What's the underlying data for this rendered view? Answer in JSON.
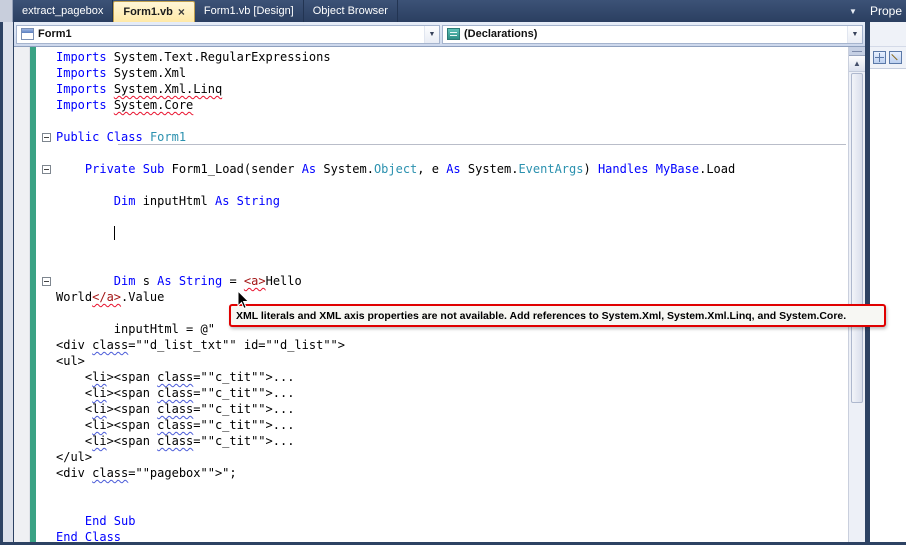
{
  "colors": {
    "keyword": "#0000FF",
    "type": "#2B91AF",
    "xml_literal": "#A31515",
    "squiggle_error": "#E8112D",
    "squiggle_warning": "#4A5BD8",
    "change_bar": "#3AA284",
    "active_tab": "#FFE9A7",
    "title_bar": "#2D4263",
    "error_border": "#E00000"
  },
  "icons": {
    "close": "×",
    "tab_overflow": "▼",
    "combo_dropdown": "▼",
    "scroll_up": "▲"
  },
  "tabbar": {
    "tabs": [
      {
        "label": "extract_pagebox",
        "active": false,
        "close": false
      },
      {
        "label": "Form1.vb",
        "active": true,
        "close": true
      },
      {
        "label": "Form1.vb [Design]",
        "active": false,
        "close": false
      },
      {
        "label": "Object Browser",
        "active": false,
        "close": false
      }
    ],
    "right_panel_title": "Prope"
  },
  "navbar": {
    "object_combo": "Form1",
    "member_combo": "(Declarations)"
  },
  "tooltip": {
    "text": "XML literals and XML axis properties are not available. Add references to System.Xml, System.Xml.Linq, and System.Core."
  },
  "code": {
    "lines": [
      {
        "s": [
          {
            "t": "Imports",
            "c": "kw"
          },
          {
            "t": " System.Text.RegularExpressions",
            "c": "pl"
          }
        ]
      },
      {
        "s": [
          {
            "t": "Imports",
            "c": "kw"
          },
          {
            "t": " System.Xml",
            "c": "pl"
          }
        ]
      },
      {
        "s": [
          {
            "t": "Imports",
            "c": "kw"
          },
          {
            "t": " ",
            "c": "pl"
          },
          {
            "t": "System.Xml.Linq",
            "c": "pl",
            "sq": "red"
          }
        ]
      },
      {
        "s": [
          {
            "t": "Imports",
            "c": "kw"
          },
          {
            "t": " ",
            "c": "pl"
          },
          {
            "t": "System.Core",
            "c": "pl",
            "sq": "red"
          }
        ]
      },
      {
        "s": []
      },
      {
        "fold": true,
        "sep": true,
        "s": [
          {
            "t": "Public",
            "c": "kw"
          },
          {
            "t": " ",
            "c": "pl"
          },
          {
            "t": "Class",
            "c": "kw"
          },
          {
            "t": " ",
            "c": "pl"
          },
          {
            "t": "Form1",
            "c": "ty"
          }
        ]
      },
      {
        "s": []
      },
      {
        "fold": true,
        "s": [
          {
            "t": "    ",
            "c": "pl"
          },
          {
            "t": "Private",
            "c": "kw"
          },
          {
            "t": " ",
            "c": "pl"
          },
          {
            "t": "Sub",
            "c": "kw"
          },
          {
            "t": " Form1_Load(sender ",
            "c": "pl"
          },
          {
            "t": "As",
            "c": "kw"
          },
          {
            "t": " System.",
            "c": "pl"
          },
          {
            "t": "Object",
            "c": "ty"
          },
          {
            "t": ", e ",
            "c": "pl"
          },
          {
            "t": "As",
            "c": "kw"
          },
          {
            "t": " System.",
            "c": "pl"
          },
          {
            "t": "EventArgs",
            "c": "ty"
          },
          {
            "t": ") ",
            "c": "pl"
          },
          {
            "t": "Handles",
            "c": "kw"
          },
          {
            "t": " ",
            "c": "pl"
          },
          {
            "t": "MyBase",
            "c": "kw"
          },
          {
            "t": ".Load",
            "c": "pl"
          }
        ]
      },
      {
        "s": []
      },
      {
        "s": [
          {
            "t": "        ",
            "c": "pl"
          },
          {
            "t": "Dim",
            "c": "kw"
          },
          {
            "t": " inputHtml ",
            "c": "pl"
          },
          {
            "t": "As",
            "c": "kw"
          },
          {
            "t": " ",
            "c": "pl"
          },
          {
            "t": "String",
            "c": "kw"
          }
        ]
      },
      {
        "s": []
      },
      {
        "caret": true,
        "s": []
      },
      {
        "s": []
      },
      {
        "s": []
      },
      {
        "fold": true,
        "s": [
          {
            "t": "        ",
            "c": "pl"
          },
          {
            "t": "Dim",
            "c": "kw"
          },
          {
            "t": " s ",
            "c": "pl"
          },
          {
            "t": "As",
            "c": "kw"
          },
          {
            "t": " ",
            "c": "pl"
          },
          {
            "t": "String",
            "c": "kw"
          },
          {
            "t": " = ",
            "c": "pl"
          },
          {
            "t": "<a>",
            "c": "xml",
            "sq": "red"
          },
          {
            "t": "Hello",
            "c": "pl"
          }
        ]
      },
      {
        "s": [
          {
            "t": "World",
            "c": "pl"
          },
          {
            "t": "</a>",
            "c": "xml",
            "sq": "red"
          },
          {
            "t": ".Value",
            "c": "pl"
          }
        ]
      },
      {
        "s": []
      },
      {
        "s": [
          {
            "t": "        inputHtml = @\"",
            "c": "pl"
          }
        ]
      },
      {
        "s": [
          {
            "t": "<div ",
            "c": "pl"
          },
          {
            "t": "class",
            "c": "pl",
            "sq": "blue"
          },
          {
            "t": "=\"\"d_list_txt\"\" id=\"\"d_list\"\">",
            "c": "pl"
          }
        ]
      },
      {
        "s": [
          {
            "t": "<ul>",
            "c": "pl"
          }
        ]
      },
      {
        "s": [
          {
            "t": "    <",
            "c": "pl"
          },
          {
            "t": "li",
            "c": "pl",
            "sq": "blue"
          },
          {
            "t": "><span ",
            "c": "pl"
          },
          {
            "t": "class",
            "c": "pl",
            "sq": "blue"
          },
          {
            "t": "=\"\"c_tit\"\">...",
            "c": "pl"
          }
        ]
      },
      {
        "s": [
          {
            "t": "    <",
            "c": "pl"
          },
          {
            "t": "li",
            "c": "pl",
            "sq": "blue"
          },
          {
            "t": "><span ",
            "c": "pl"
          },
          {
            "t": "class",
            "c": "pl",
            "sq": "blue"
          },
          {
            "t": "=\"\"c_tit\"\">...",
            "c": "pl"
          }
        ]
      },
      {
        "s": [
          {
            "t": "    <",
            "c": "pl"
          },
          {
            "t": "li",
            "c": "pl",
            "sq": "blue"
          },
          {
            "t": "><span ",
            "c": "pl"
          },
          {
            "t": "class",
            "c": "pl",
            "sq": "blue"
          },
          {
            "t": "=\"\"c_tit\"\">...",
            "c": "pl"
          }
        ]
      },
      {
        "s": [
          {
            "t": "    <",
            "c": "pl"
          },
          {
            "t": "li",
            "c": "pl",
            "sq": "blue"
          },
          {
            "t": "><span ",
            "c": "pl"
          },
          {
            "t": "class",
            "c": "pl",
            "sq": "blue"
          },
          {
            "t": "=\"\"c_tit\"\">...",
            "c": "pl"
          }
        ]
      },
      {
        "s": [
          {
            "t": "    <",
            "c": "pl"
          },
          {
            "t": "li",
            "c": "pl",
            "sq": "blue"
          },
          {
            "t": "><span ",
            "c": "pl"
          },
          {
            "t": "class",
            "c": "pl",
            "sq": "blue"
          },
          {
            "t": "=\"\"c_tit\"\">...",
            "c": "pl"
          }
        ]
      },
      {
        "s": [
          {
            "t": "</ul>",
            "c": "pl"
          }
        ]
      },
      {
        "s": [
          {
            "t": "<div ",
            "c": "pl"
          },
          {
            "t": "class",
            "c": "pl",
            "sq": "blue"
          },
          {
            "t": "=\"\"pagebox\"\">\";",
            "c": "pl"
          }
        ]
      },
      {
        "s": []
      },
      {
        "s": []
      },
      {
        "s": [
          {
            "t": "    ",
            "c": "pl"
          },
          {
            "t": "End Sub",
            "c": "kw"
          }
        ]
      },
      {
        "s": [
          {
            "t": "End Class",
            "c": "kw",
            "sq": "blue"
          }
        ]
      }
    ]
  }
}
